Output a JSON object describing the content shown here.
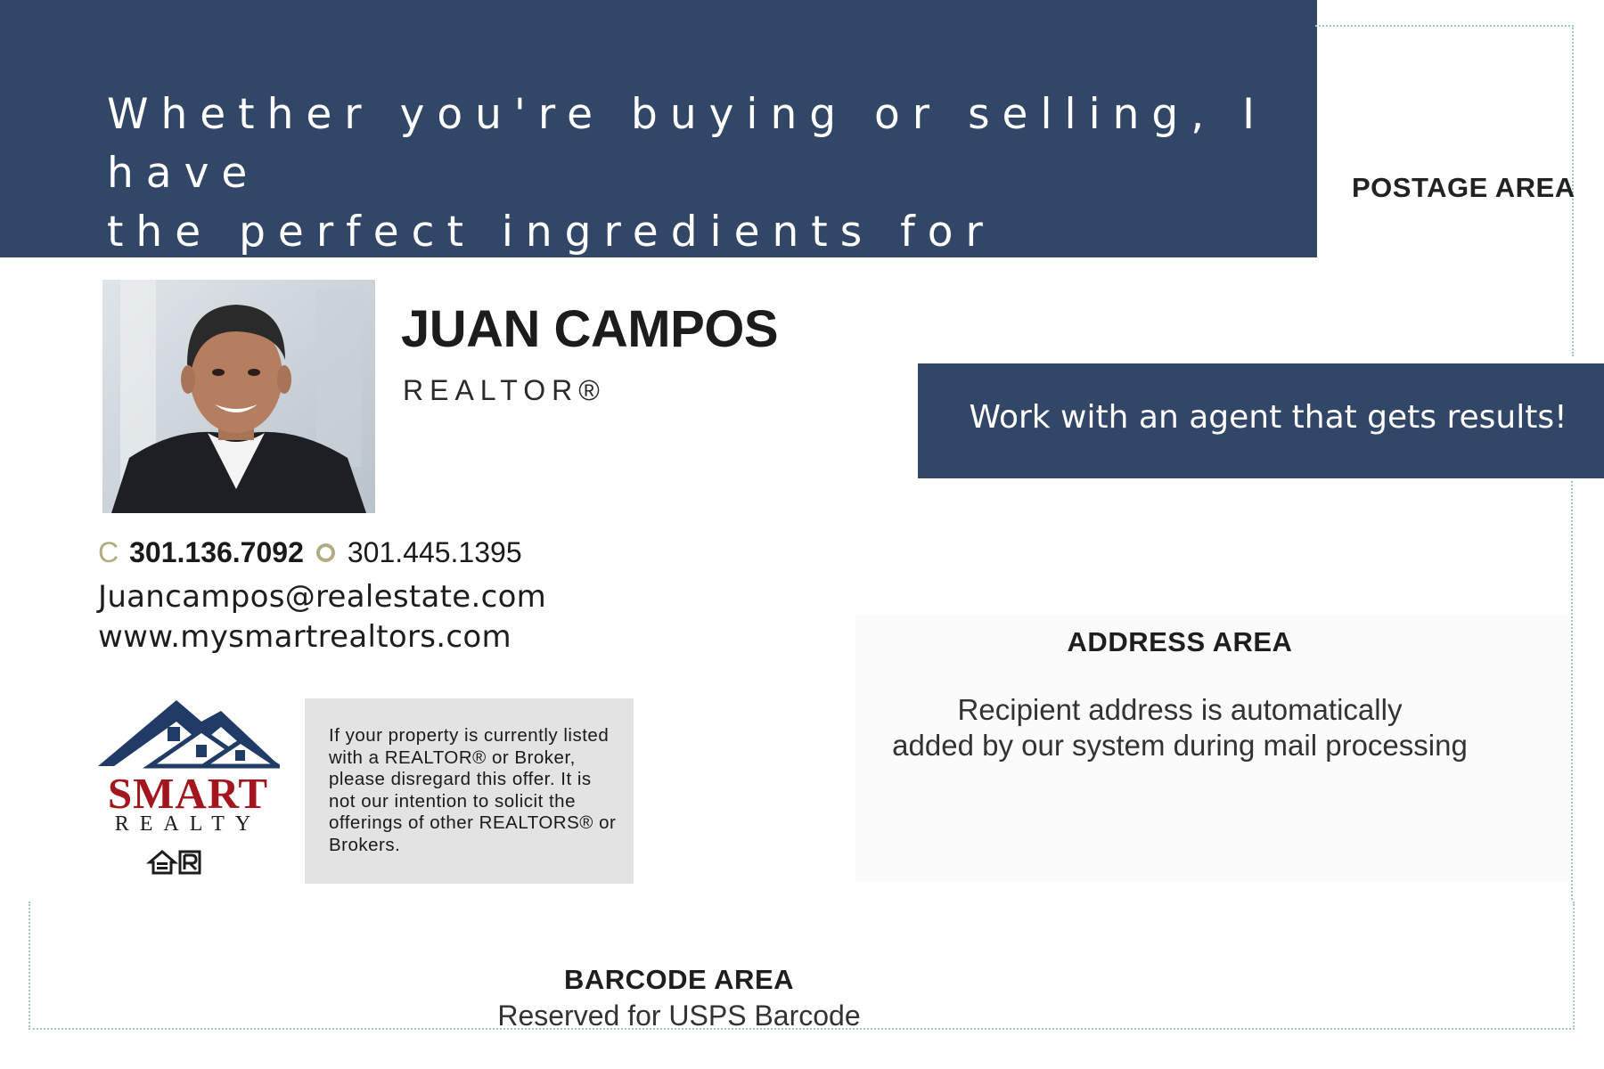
{
  "headline": {
    "line1": "Whether you're buying or selling, I have",
    "line2": "the perfect ingredients for success!"
  },
  "postage": {
    "label": "POSTAGE AREA"
  },
  "agent": {
    "name": "JUAN CAMPOS",
    "title": "REALTOR®",
    "cell_prefix": "C",
    "cell_phone": "301.136.7092",
    "office_phone": "301.445.1395",
    "email": "Juancampos@realestate.com",
    "website": "www.mysmartrealtors.com"
  },
  "logo": {
    "brand_top": "SMART",
    "brand_bottom": "REALTY"
  },
  "disclaimer": {
    "text": "If your property is currently listed with a REALTOR® or Broker, please disregard this offer. It is not our intention to solicit the offerings of other REALTORS® or Brokers."
  },
  "tagline": {
    "text": "Work with an agent that gets results!"
  },
  "address_area": {
    "title": "ADDRESS AREA",
    "line1": "Recipient address is automatically",
    "line2": "added by our system during mail processing"
  },
  "barcode_area": {
    "title": "BARCODE AREA",
    "desc": "Reserved for USPS Barcode"
  },
  "colors": {
    "navy_band": "#324668",
    "gold_accent": "#b2ab83",
    "logo_red": "#a3161d",
    "logo_blue": "#1f3b66"
  }
}
